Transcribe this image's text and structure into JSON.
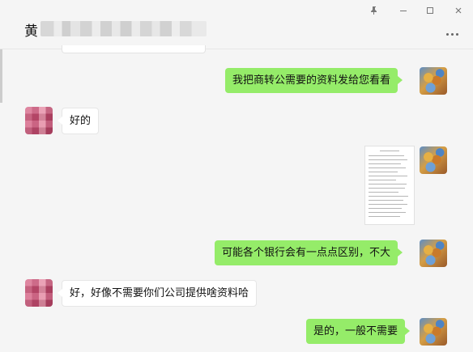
{
  "window": {
    "title_prefix": "黄",
    "controls": {
      "pin_icon": "pin-icon",
      "minimize_icon": "minimize-icon",
      "maximize_icon": "maximize-icon",
      "close_icon": "close-icon",
      "more_icon": "more-icon"
    }
  },
  "messages": [
    {
      "side": "me",
      "text": "我把商转公需要的资料发给您看看"
    },
    {
      "side": "other",
      "text": "好的"
    },
    {
      "side": "me",
      "type": "document-image"
    },
    {
      "side": "me",
      "text": "可能各个银行会有一点点区别，不大"
    },
    {
      "side": "other",
      "text": "好，好像不需要你们公司提供啥资料哈"
    },
    {
      "side": "me",
      "text": "是的，一般不需要"
    }
  ],
  "colors": {
    "background": "#f5f5f5",
    "my_bubble": "#95ec69",
    "other_bubble": "#ffffff"
  }
}
